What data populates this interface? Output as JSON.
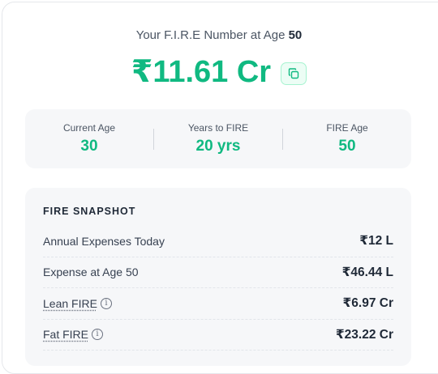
{
  "header": {
    "prefix": "Your F.I.R.E Number at Age",
    "age": "50"
  },
  "fire_number": "₹11.61 Cr",
  "stats": [
    {
      "label": "Current Age",
      "value": "30"
    },
    {
      "label": "Years to FIRE",
      "value": "20 yrs"
    },
    {
      "label": "FIRE Age",
      "value": "50"
    }
  ],
  "snapshot": {
    "title": "FIRE SNAPSHOT",
    "rows": [
      {
        "label": "Annual Expenses Today",
        "value": "₹12 L"
      },
      {
        "label": "Expense at Age 50",
        "value": "₹46.44 L"
      },
      {
        "label": "Lean FIRE",
        "value": "₹6.97 Cr"
      },
      {
        "label": "Fat FIRE",
        "value": "₹23.22 Cr"
      }
    ]
  },
  "icons": {
    "copy": "copy-icon",
    "info": "info-icon"
  },
  "colors": {
    "accent": "#10b981",
    "panel": "#f6f7f9"
  }
}
